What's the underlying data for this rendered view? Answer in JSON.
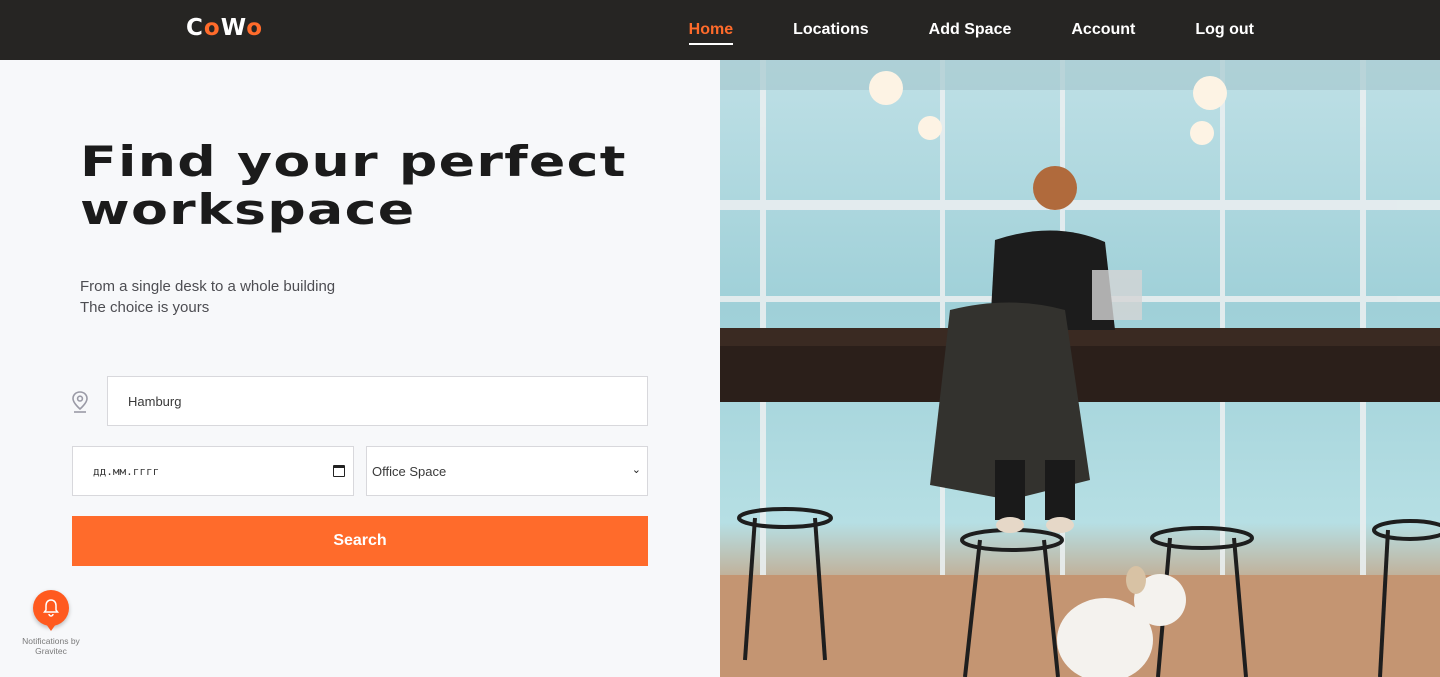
{
  "header": {
    "logo": {
      "part1": "C",
      "part2": "o",
      "part3": "W",
      "part4": "o"
    },
    "nav": [
      {
        "label": "Home",
        "active": true
      },
      {
        "label": "Locations"
      },
      {
        "label": "Add Space"
      },
      {
        "label": "Account"
      },
      {
        "label": "Log out"
      }
    ]
  },
  "hero": {
    "title_line1": "Find your perfect",
    "title_line2": "workspace",
    "subtitle_line1": "From a single desk to a whole building",
    "subtitle_line2": "The choice is yours"
  },
  "search_form": {
    "city_value": "Hamburg",
    "date_placeholder": "дд.мм.гггг",
    "space_type_selected": "Office Space",
    "search_label": "Search"
  },
  "notification_widget": {
    "label": "Notifications by Gravitec"
  },
  "colors": {
    "accent": "#ff6b2b",
    "nav_bg": "#262523",
    "page_bg": "#f7f8fa"
  },
  "icons": {
    "location": "location-pin-icon",
    "calendar": "calendar-icon",
    "dropdown": "chevron-down-icon",
    "bell": "bell-icon"
  }
}
